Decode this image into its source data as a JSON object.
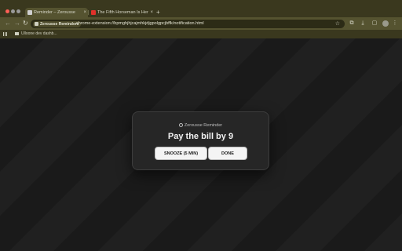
{
  "browser": {
    "tabs": [
      {
        "title": "Reminder – Zerousse",
        "active": true
      },
      {
        "title": "The Fifth Horseman Is Here",
        "active": false
      }
    ],
    "new_tab_label": "+",
    "site_chip": "Zerousse Reminders",
    "url": "chrome-extension://bpmghjhjcajmhkjdjgpolgpcjbffk/notification.html",
    "bookmark": "Ulloone dev dashb..."
  },
  "notification": {
    "brand": "Zerousse Reminder",
    "message": "Pay the bill by 9",
    "snooze_label": "SNOOZE (5 MIN)",
    "done_label": "DONE"
  },
  "icons": {
    "back": "back-arrow-icon",
    "forward": "forward-arrow-icon",
    "reload": "reload-icon",
    "star": "star-icon"
  }
}
